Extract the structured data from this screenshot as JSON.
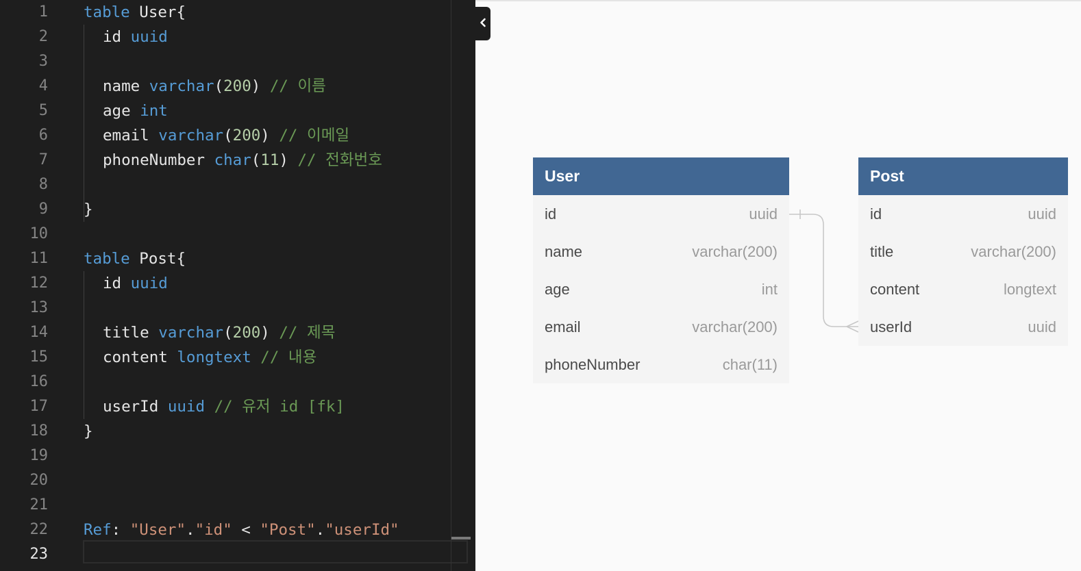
{
  "editor": {
    "line_numbers": [
      "1",
      "2",
      "3",
      "4",
      "5",
      "6",
      "7",
      "8",
      "9",
      "10",
      "11",
      "12",
      "13",
      "14",
      "15",
      "16",
      "17",
      "18",
      "19",
      "20",
      "21",
      "22",
      "23"
    ],
    "lines": {
      "l1": {
        "kw": "table",
        "name": "User{"
      },
      "l2": {
        "field": "id",
        "type": "uuid"
      },
      "l4": {
        "field": "name",
        "type": "varchar",
        "open": "(",
        "num": "200",
        "close": ")",
        "comment": "// 이름"
      },
      "l5": {
        "field": "age",
        "type": "int"
      },
      "l6": {
        "field": "email",
        "type": "varchar",
        "open": "(",
        "num": "200",
        "close": ")",
        "comment": "// 이메일"
      },
      "l7": {
        "field": "phoneNumber",
        "type": "char",
        "open": "(",
        "num": "11",
        "close": ")",
        "comment": "// 전화번호"
      },
      "l9": {
        "text": "}"
      },
      "l11": {
        "kw": "table",
        "name": "Post{"
      },
      "l12": {
        "field": "id",
        "type": "uuid"
      },
      "l14": {
        "field": "title",
        "type": "varchar",
        "open": "(",
        "num": "200",
        "close": ")",
        "comment": "// 제목"
      },
      "l15": {
        "field": "content",
        "type": "longtext",
        "comment": "// 내용"
      },
      "l17": {
        "field": "userId",
        "type": "uuid",
        "comment": "// 유저 id [fk]"
      },
      "l18": {
        "text": "}"
      },
      "l22": {
        "kw": "Ref",
        "colon": ":",
        "s1": "\"User\"",
        "dot1": ".",
        "s2": "\"id\"",
        "op": "<",
        "s3": "\"Post\"",
        "dot2": ".",
        "s4": "\"userId\""
      }
    },
    "active_line": "23"
  },
  "toggle": {
    "icon": "chevron-left-icon"
  },
  "diagram": {
    "tables": [
      {
        "name": "User",
        "fields": [
          {
            "name": "id",
            "type": "uuid"
          },
          {
            "name": "name",
            "type": "varchar(200)"
          },
          {
            "name": "age",
            "type": "int"
          },
          {
            "name": "email",
            "type": "varchar(200)"
          },
          {
            "name": "phoneNumber",
            "type": "char(11)"
          }
        ]
      },
      {
        "name": "Post",
        "fields": [
          {
            "name": "id",
            "type": "uuid"
          },
          {
            "name": "title",
            "type": "varchar(200)"
          },
          {
            "name": "content",
            "type": "longtext"
          },
          {
            "name": "userId",
            "type": "uuid"
          }
        ]
      }
    ],
    "relationship": {
      "from": "User.id",
      "to": "Post.userId",
      "kind": "one-to-many"
    }
  },
  "colors": {
    "editor_bg": "#1e1e1e",
    "keyword": "#569cd6",
    "comment": "#6a9955",
    "number": "#b5cea8",
    "string": "#ce9178",
    "table_header": "#416793",
    "table_body": "#f4f4f4"
  }
}
